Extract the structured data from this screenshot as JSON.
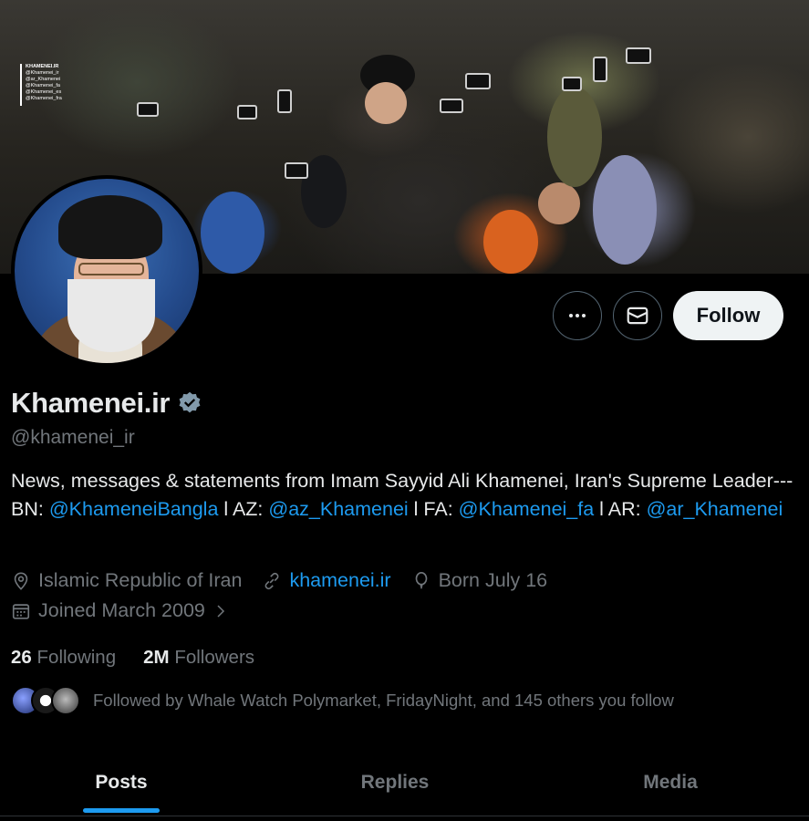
{
  "banner": {
    "watermark_lines": [
      "KHAMENEI.IR",
      "@Khamenei_ir",
      "@ar_Khamenei",
      "@Khamenei_fa",
      "@Khamenei_es",
      "@Khamenei_fra"
    ]
  },
  "actions": {
    "more_icon": "more-horizontal-icon",
    "message_icon": "envelope-icon",
    "follow_label": "Follow"
  },
  "profile": {
    "display_name": "Khamenei.ir",
    "verified_icon": "verified-badge-icon",
    "handle": "@khamenei_ir",
    "bio": {
      "text1": "News, messages & statements from Imam Sayyid Ali Khamenei, Iran's Supreme Leader--- BN: ",
      "link1": "@KhameneiBangla",
      "text2": " l AZ: ",
      "link2": "@az_Khamenei",
      "text3": " l FA: ",
      "link3": "@Khamenei_fa",
      "text4": " l AR: ",
      "link4": "@ar_Khamenei"
    },
    "location": "Islamic Republic of Iran",
    "website": "khamenei.ir",
    "birthday": "Born July 16",
    "joined": "Joined March 2009",
    "following_count": "26",
    "following_label": "Following",
    "followers_count": "2M",
    "followers_label": "Followers",
    "followed_by": "Followed by Whale Watch Polymarket, FridayNight, and 145 others you follow"
  },
  "tabs": [
    {
      "label": "Posts",
      "active": true
    },
    {
      "label": "Replies",
      "active": false
    },
    {
      "label": "Media",
      "active": false
    }
  ],
  "colors": {
    "accent": "#1d9bf0",
    "muted": "#71767b",
    "background": "#000000"
  }
}
